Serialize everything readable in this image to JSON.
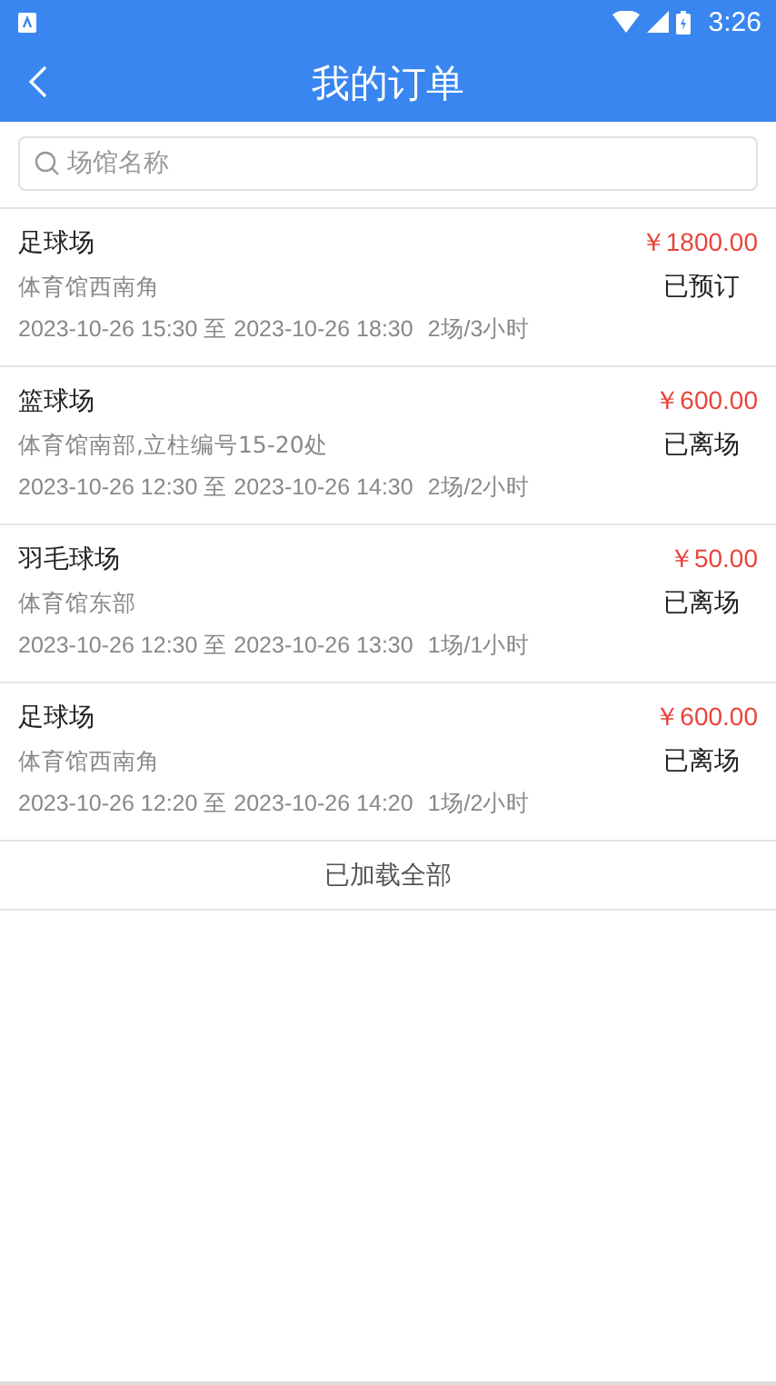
{
  "status_bar": {
    "time": "3:26"
  },
  "header": {
    "title": "我的订单"
  },
  "search": {
    "placeholder": "场馆名称"
  },
  "orders": [
    {
      "venue": "足球场",
      "price": "￥1800.00",
      "location": "体育馆西南角",
      "status": "已预订",
      "time_range": "2023-10-26 15:30 至 2023-10-26 18:30",
      "usage": "2场/3小时"
    },
    {
      "venue": "篮球场",
      "price": "￥600.00",
      "location": "体育馆南部,立柱编号15-20处",
      "status": "已离场",
      "time_range": "2023-10-26 12:30 至 2023-10-26 14:30",
      "usage": "2场/2小时"
    },
    {
      "venue": "羽毛球场",
      "price": "￥50.00",
      "location": "体育馆东部",
      "status": "已离场",
      "time_range": "2023-10-26 12:30 至 2023-10-26 13:30",
      "usage": "1场/1小时"
    },
    {
      "venue": "足球场",
      "price": "￥600.00",
      "location": "体育馆西南角",
      "status": "已离场",
      "time_range": "2023-10-26 12:20 至 2023-10-26 14:20",
      "usage": "1场/2小时"
    }
  ],
  "footer": {
    "text": "已加载全部"
  }
}
